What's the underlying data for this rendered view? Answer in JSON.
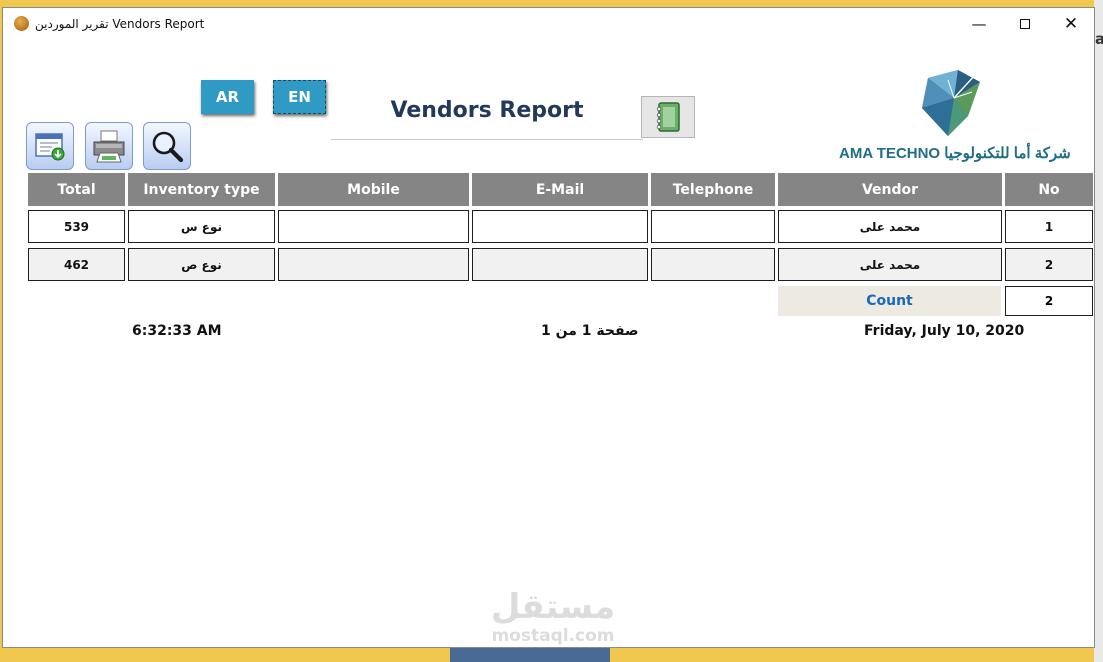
{
  "window": {
    "title": "تقرير الموردين  Vendors Report",
    "controls": {
      "minimize": "—",
      "close": "✕"
    }
  },
  "toolbar": {
    "lang_ar": "AR",
    "lang_en": "EN",
    "icons": [
      "export-icon",
      "printer-icon",
      "magnifier-icon",
      "notebook-icon"
    ]
  },
  "report": {
    "title": "Vendors Report",
    "company": "AMA TECHNO شركة أما للتكنولوجيا"
  },
  "table": {
    "columns": [
      "Total",
      "Inventory type",
      "Mobile",
      "E-Mail",
      "Telephone",
      "Vendor",
      "No"
    ],
    "rows": [
      {
        "total": "539",
        "inventory_type": "نوع س",
        "mobile": "",
        "email": "",
        "telephone": "",
        "vendor": "محمد على",
        "no": "1"
      },
      {
        "total": "462",
        "inventory_type": "نوع ص",
        "mobile": "",
        "email": "",
        "telephone": "",
        "vendor": "محمد على",
        "no": "2"
      }
    ]
  },
  "summary": {
    "count_label": "Count",
    "count_value": "2"
  },
  "footer": {
    "time": "6:32:33 AM",
    "page": "صفحة 1 من 1",
    "date": "Friday, July 10, 2020"
  },
  "watermark": {
    "arabic": "مستقل",
    "latin": "mostaql.com"
  },
  "background": {
    "fragment": "al"
  },
  "colors": {
    "lang_button": "#2f9ac4",
    "header_bg": "#858585",
    "title": "#23395b",
    "count_label": "#1b67b8",
    "company": "#1f6e84"
  }
}
